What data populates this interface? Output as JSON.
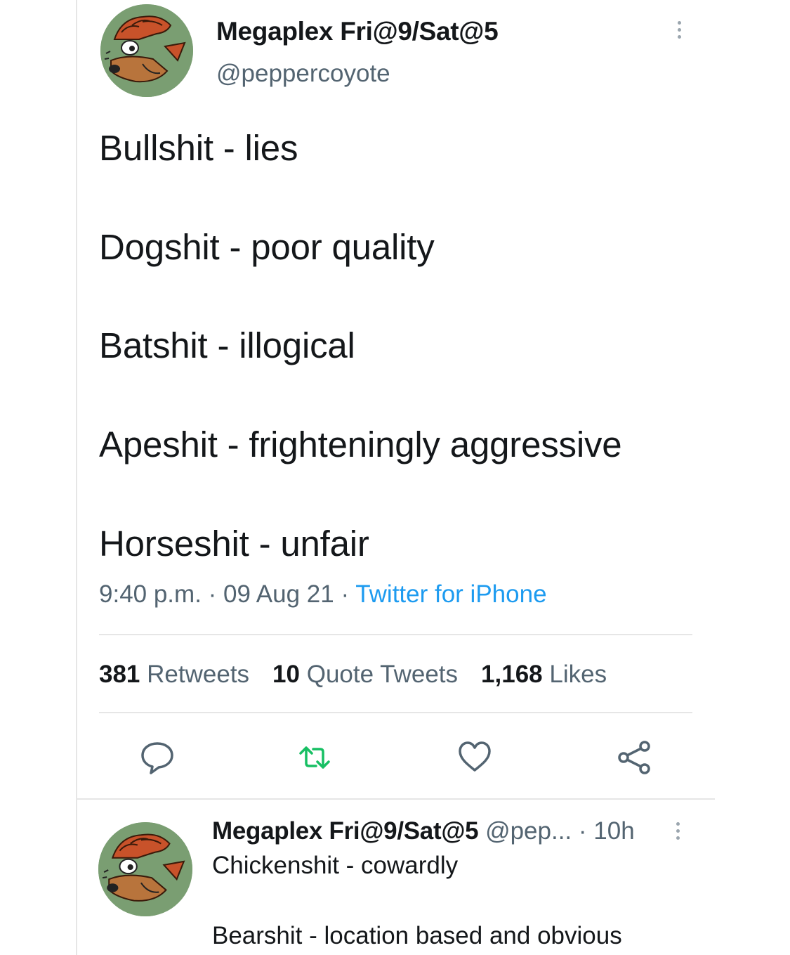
{
  "tweet": {
    "author_name": "Megaplex Fri@9/Sat@5",
    "author_handle": "@peppercoyote",
    "lines": [
      "Bullshit - lies",
      "Dogshit - poor quality",
      "Batshit - illogical",
      "Apeshit - frighteningly aggressive",
      "Horseshit - unfair"
    ],
    "time": "9:40 p.m.",
    "date": "09 Aug 21",
    "separator": "·",
    "source": "Twitter for iPhone",
    "avatar_icon": "coyote-avatar-icon"
  },
  "stats": {
    "retweets_count": "381",
    "retweets_label": "Retweets",
    "quotes_count": "10",
    "quotes_label": "Quote Tweets",
    "likes_count": "1,168",
    "likes_label": "Likes"
  },
  "actions": {
    "reply_icon": "reply-icon",
    "retweet_icon": "retweet-icon",
    "like_icon": "heart-icon",
    "share_icon": "share-icon"
  },
  "reply": {
    "author_name": "Megaplex Fri@9/Sat@5",
    "author_handle": "@pep...",
    "separator": "·",
    "age": "10h",
    "line1": "Chickenshit - cowardly",
    "line2": "Bearshit - location based and obvious"
  },
  "colors": {
    "text": "#14171a",
    "muted": "#536471",
    "link": "#1d9bf0",
    "retweet_green": "#17bf63",
    "divider": "#e6e6e6"
  }
}
